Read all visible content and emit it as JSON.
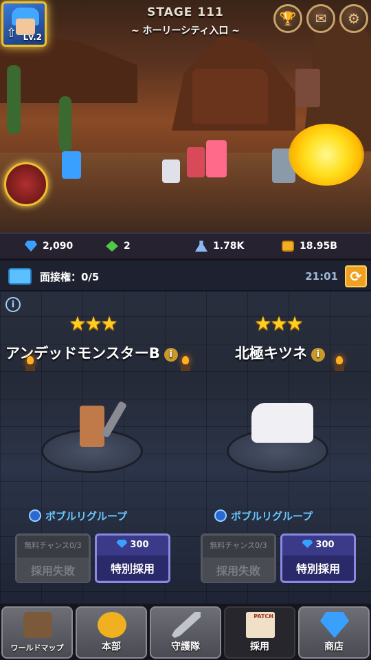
{
  "stage": {
    "title": "STAGE 111",
    "subtitle": "~ ホーリーシティ入口 ~"
  },
  "player": {
    "level": "Lv.2"
  },
  "top_icons": [
    "trophy-icon",
    "mail-icon",
    "settings-icon"
  ],
  "currency": {
    "gems": "2,090",
    "green_gems": "2",
    "potions": "1.78K",
    "gold": "18.95B"
  },
  "interview": {
    "label": "面接権：0/5",
    "timer": "21:01"
  },
  "candidates": [
    {
      "stars": "★★★",
      "name": "アンデッドモンスターB",
      "group": "ポブルリグループ",
      "free_chance": "無料チャンス0/3",
      "fail_label": "採用失敗",
      "cost": "300",
      "special_label": "特別採用"
    },
    {
      "stars": "★★★",
      "name": "北極キツネ",
      "group": "ポブルリグループ",
      "free_chance": "無料チャンス0/3",
      "fail_label": "採用失敗",
      "cost": "300",
      "special_label": "特別採用"
    }
  ],
  "nav": [
    {
      "label": "ワールドマップ",
      "icon": "map-icon"
    },
    {
      "label": "本部",
      "icon": "gold-icon"
    },
    {
      "label": "守護隊",
      "icon": "sword-icon"
    },
    {
      "label": "採用",
      "icon": "recruit-poster-icon",
      "badge": "PATCH",
      "active": true
    },
    {
      "label": "商店",
      "icon": "diamond-icon"
    }
  ],
  "colors": {
    "accent_gold": "#f0c030",
    "special_button": "#3a3a88",
    "group_text": "#6ac8ff"
  }
}
